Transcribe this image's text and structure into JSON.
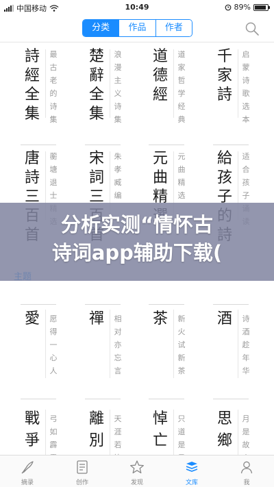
{
  "status": {
    "carrier": "中国移动",
    "time": "10:49",
    "battery": "89%",
    "battery_level": 0.89
  },
  "nav": {
    "tabs": [
      {
        "label": "分类",
        "active": true
      },
      {
        "label": "作品",
        "active": false
      },
      {
        "label": "作者",
        "active": false
      }
    ]
  },
  "collections": [
    {
      "title": "詩經全集",
      "sub": "最古老的诗集"
    },
    {
      "title": "楚辭全集",
      "sub": "浪漫主义诗集"
    },
    {
      "title": "道德經",
      "sub": "道家哲学经典"
    },
    {
      "title": "千家詩",
      "sub": "启蒙诗歌选本"
    },
    {
      "title": "唐詩三百首",
      "sub": "蘅塘退士精选"
    },
    {
      "title": "宋詞三百首",
      "sub": "朱孝臧编"
    },
    {
      "title": "元曲精選",
      "sub": "元曲精选"
    },
    {
      "title": "給孩子的詩",
      "sub": "适合孩子诵读"
    }
  ],
  "section": {
    "title": "主题"
  },
  "themes": [
    {
      "title": "愛",
      "sub": "愿得一心人"
    },
    {
      "title": "禪",
      "sub": "相对亦忘言"
    },
    {
      "title": "茶",
      "sub": "新火试新茶"
    },
    {
      "title": "酒",
      "sub": "诗酒趁年华"
    },
    {
      "title": "戰爭",
      "sub": "弓如霹雳"
    },
    {
      "title": "離別",
      "sub": "天涯若比"
    },
    {
      "title": "悼亡",
      "sub": "只道是寻"
    },
    {
      "title": "思鄉",
      "sub": "月是故乡"
    }
  ],
  "banner": {
    "text": "分析实测“情怀古\n诗词app辅助下载("
  },
  "tabbar": {
    "items": [
      {
        "label": "摘录",
        "icon": "quill-icon",
        "active": false
      },
      {
        "label": "创作",
        "icon": "notebook-icon",
        "active": false
      },
      {
        "label": "发现",
        "icon": "star-icon",
        "active": false
      },
      {
        "label": "文库",
        "icon": "library-icon",
        "active": true
      },
      {
        "label": "我",
        "icon": "person-icon",
        "active": false
      }
    ]
  },
  "colors": {
    "accent": "#1a8cff",
    "banner": "#8084a0"
  }
}
